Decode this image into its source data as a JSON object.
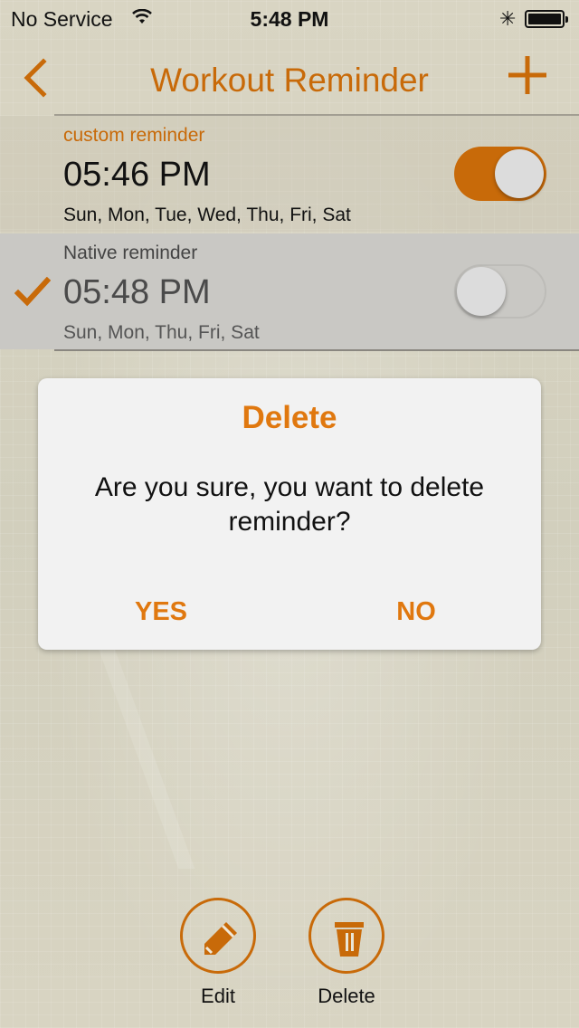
{
  "status_bar": {
    "carrier": "No Service",
    "time": "5:48 PM",
    "bluetooth_icon": "bluetooth-icon",
    "wifi_icon": "wifi-icon",
    "battery_icon": "battery-icon"
  },
  "nav": {
    "title": "Workout Reminder",
    "back_icon": "chevron-left-icon",
    "add_icon": "plus-icon"
  },
  "reminders": [
    {
      "label": "custom reminder",
      "time": "05:46 PM",
      "days": "Sun, Mon, Tue, Wed, Thu, Fri, Sat",
      "enabled": true,
      "selected": false
    },
    {
      "label": "Native reminder",
      "time": "05:48 PM",
      "days": "Sun, Mon, Thu, Fri, Sat",
      "enabled": false,
      "selected": true
    }
  ],
  "dialog": {
    "title": "Delete",
    "message": "Are you sure, you want to delete reminder?",
    "yes_label": "YES",
    "no_label": "NO"
  },
  "toolbar": {
    "edit_label": "Edit",
    "delete_label": "Delete",
    "edit_icon": "pencil-icon",
    "delete_icon": "trash-icon"
  },
  "colors": {
    "accent": "#c86a09",
    "dialog_accent": "#e0780f",
    "background": "#d6d2c0"
  }
}
